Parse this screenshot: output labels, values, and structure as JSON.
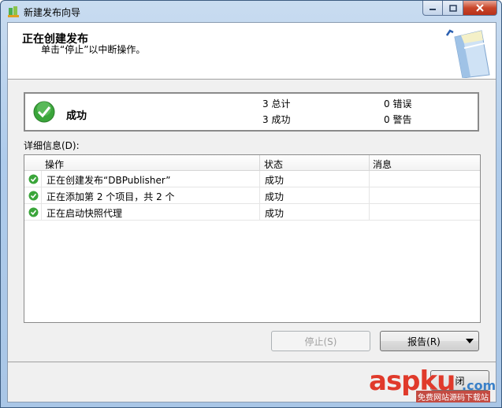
{
  "window": {
    "title": "新建发布向导"
  },
  "header": {
    "title": "正在创建发布",
    "subtitle": "单击“停止”以中断操作。"
  },
  "summary": {
    "status": "成功",
    "total": "3 总计",
    "success": "3 成功",
    "errors": "0 错误",
    "warnings": "0 警告"
  },
  "details": {
    "label": "详细信息(D):",
    "columns": [
      "操作",
      "状态",
      "消息"
    ],
    "rows": [
      {
        "action": "正在创建发布“DBPublisher”",
        "status": "成功",
        "message": ""
      },
      {
        "action": "正在添加第 2 个项目，共 2 个",
        "status": "成功",
        "message": ""
      },
      {
        "action": "正在启动快照代理",
        "status": "成功",
        "message": ""
      }
    ]
  },
  "buttons": {
    "stop": "停止(S)",
    "report": "报告(R)",
    "close": "闭"
  },
  "watermark": {
    "brand": "aspku",
    "tld": ".com",
    "tagline": "免费网站源码下载站"
  },
  "colors": {
    "success_green": "#3aa53a",
    "accent": "#e03a2b"
  },
  "icons": {
    "app": "wizard-icon",
    "success": "check-circle-icon",
    "graphic": "publication-book-icon"
  }
}
